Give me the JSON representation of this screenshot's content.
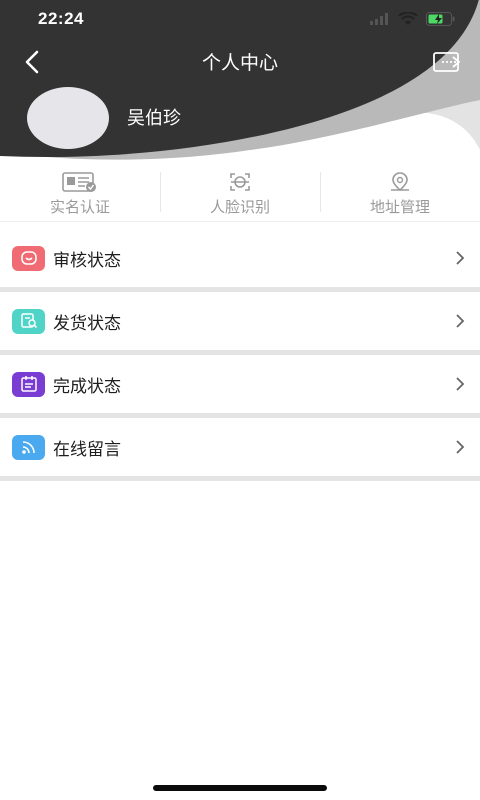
{
  "status_bar": {
    "time": "22:24",
    "icons": [
      "signal-icon",
      "wifi-icon",
      "battery-charging-icon"
    ]
  },
  "nav": {
    "title": "个人中心",
    "back_icon": "chevron-left-icon",
    "logout_icon": "logout-icon"
  },
  "profile": {
    "name": "吴伯珍"
  },
  "quick_actions": [
    {
      "label": "实名认证",
      "icon": "id-card-icon"
    },
    {
      "label": "人脸识别",
      "icon": "face-scan-icon"
    },
    {
      "label": "地址管理",
      "icon": "location-pin-icon"
    }
  ],
  "menu": [
    {
      "label": "审核状态",
      "icon": "smile-icon",
      "color": "#f06b73"
    },
    {
      "label": "发货状态",
      "icon": "document-search-icon",
      "color": "#4fd4c7"
    },
    {
      "label": "完成状态",
      "icon": "calendar-list-icon",
      "color": "#7a3dd4"
    },
    {
      "label": "在线留言",
      "icon": "rss-icon",
      "color": "#4aa9ef"
    }
  ],
  "colors": {
    "header_dark": "#333333",
    "header_arc_light": "#bdbdbd",
    "header_arc_lighter": "#e2e2e2"
  }
}
